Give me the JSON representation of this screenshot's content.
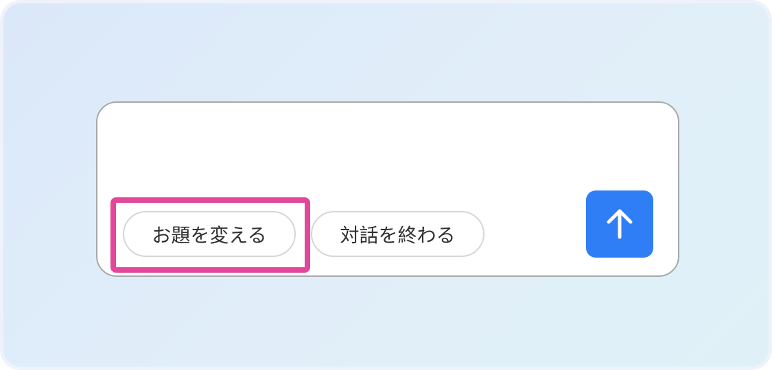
{
  "chat_input": {
    "placeholder": "",
    "value": ""
  },
  "suggestions": {
    "change_topic_label": "お題を変える",
    "end_conversation_label": "対話を終わる"
  },
  "send_button": {
    "icon": "arrow-up-icon"
  },
  "colors": {
    "send_button_bg": "#2f7ef6",
    "highlight_border": "#e2479a",
    "background_start": "#dbe8f9",
    "background_end": "#dff1f7"
  }
}
